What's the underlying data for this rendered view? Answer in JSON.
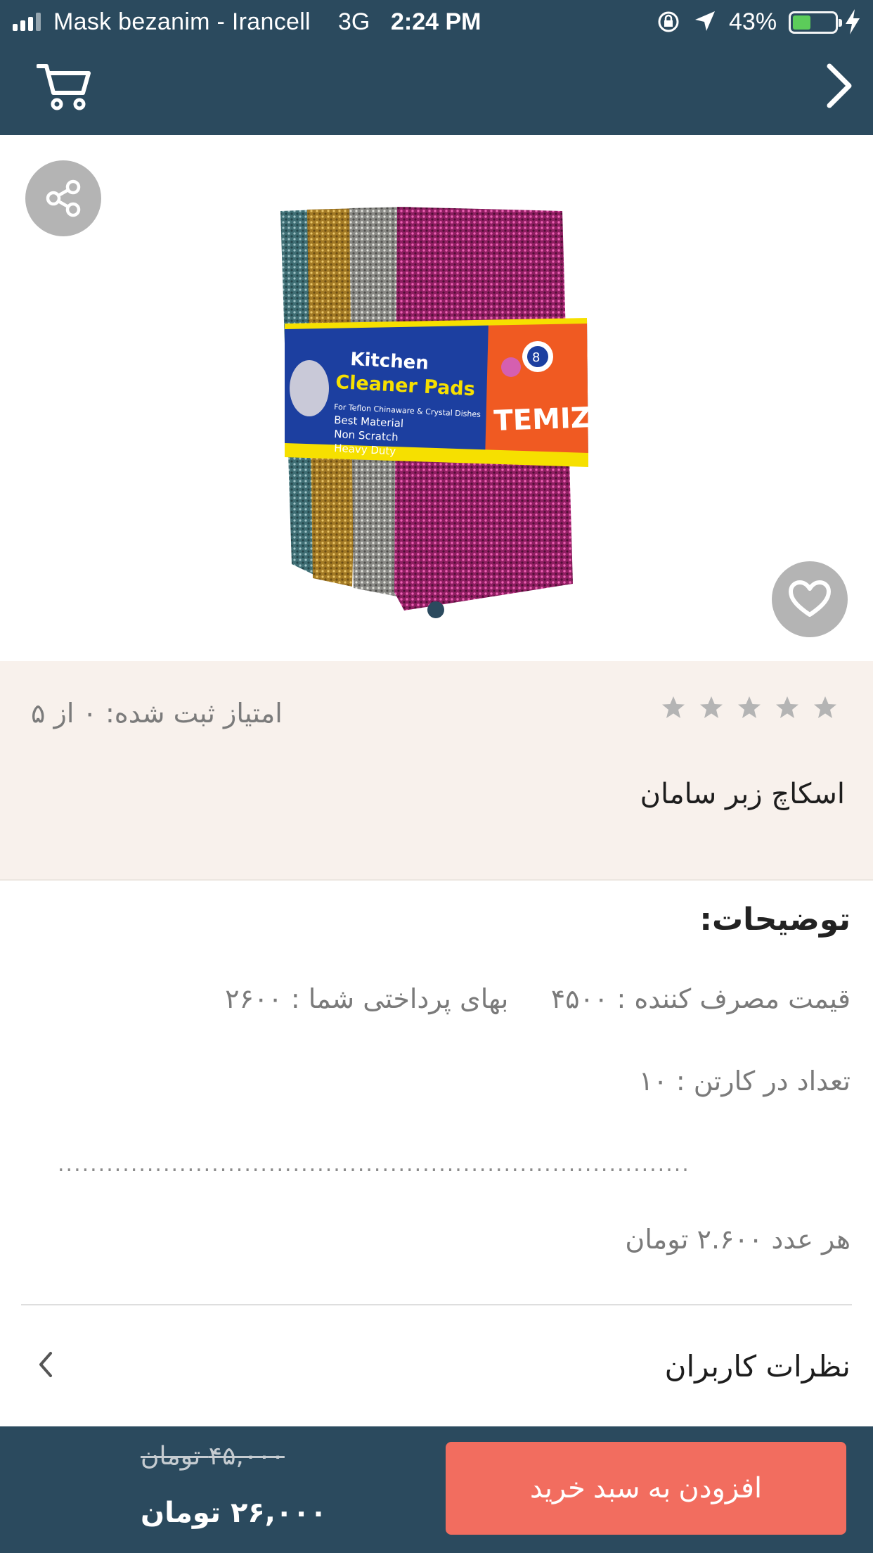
{
  "status_bar": {
    "carrier": "Mask bezanim - Irancell",
    "network": "3G",
    "time": "2:24 PM",
    "battery": "43%",
    "battery_level": 0.43
  },
  "nav": {
    "cart_icon": "cart-icon",
    "back_icon": "chevron-right-icon"
  },
  "product": {
    "image_label": "Kitchen Cleaner Pads",
    "brand": "TEMIZ",
    "title": "اسکاچ زبر سامان",
    "rating_text": "امتیاز ثبت شده: ۰ از ۵",
    "stars_total": 5,
    "stars_filled": 0
  },
  "description": {
    "heading": "توضیحات:",
    "price_line": "قیمت مصرف کننده : ۴۵۰۰     بهای پرداختی شما : ۲۶۰۰",
    "carton_line": "تعداد در کارتن : ۱۰",
    "separator": "..............................................................................",
    "unit_price": "هر عدد ۲.۶۰۰ تومان"
  },
  "comments": {
    "label": "نظرات کاربران"
  },
  "bottom": {
    "add_to_cart": "افزودن به سبد خرید",
    "old_price": "۴۵,۰۰۰ تومان",
    "new_price": "۲۶,۰۰۰ تومان"
  },
  "colors": {
    "header": "#2b4a5e",
    "accent": "#f26d5f",
    "rating_bg": "#f8f1ec",
    "star": "#b4b4b4"
  }
}
